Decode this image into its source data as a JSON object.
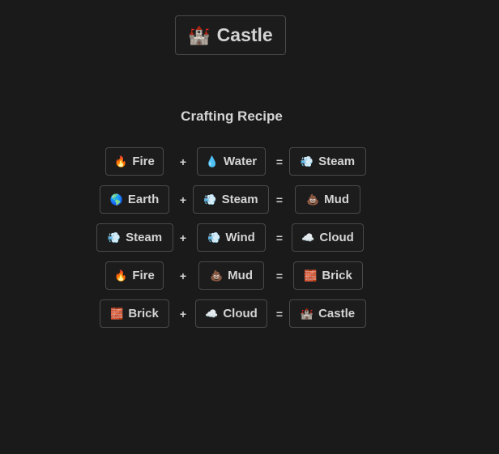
{
  "result": {
    "emoji": "🏰",
    "label": "Castle"
  },
  "heading": "Crafting Recipe",
  "operators": {
    "plus": "+",
    "equals": "="
  },
  "recipes": [
    {
      "a": {
        "emoji": "🔥",
        "label": "Fire"
      },
      "b": {
        "emoji": "💧",
        "label": "Water"
      },
      "r": {
        "emoji": "💨",
        "label": "Steam"
      }
    },
    {
      "a": {
        "emoji": "🌎",
        "label": "Earth"
      },
      "b": {
        "emoji": "💨",
        "label": "Steam"
      },
      "r": {
        "emoji": "💩",
        "label": "Mud"
      }
    },
    {
      "a": {
        "emoji": "💨",
        "label": "Steam"
      },
      "b": {
        "emoji": "💨",
        "label": "Wind"
      },
      "r": {
        "emoji": "☁️",
        "label": "Cloud"
      }
    },
    {
      "a": {
        "emoji": "🔥",
        "label": "Fire"
      },
      "b": {
        "emoji": "💩",
        "label": "Mud"
      },
      "r": {
        "emoji": "🧱",
        "label": "Brick"
      }
    },
    {
      "a": {
        "emoji": "🧱",
        "label": "Brick"
      },
      "b": {
        "emoji": "☁️",
        "label": "Cloud"
      },
      "r": {
        "emoji": "🏰",
        "label": "Castle"
      }
    }
  ]
}
